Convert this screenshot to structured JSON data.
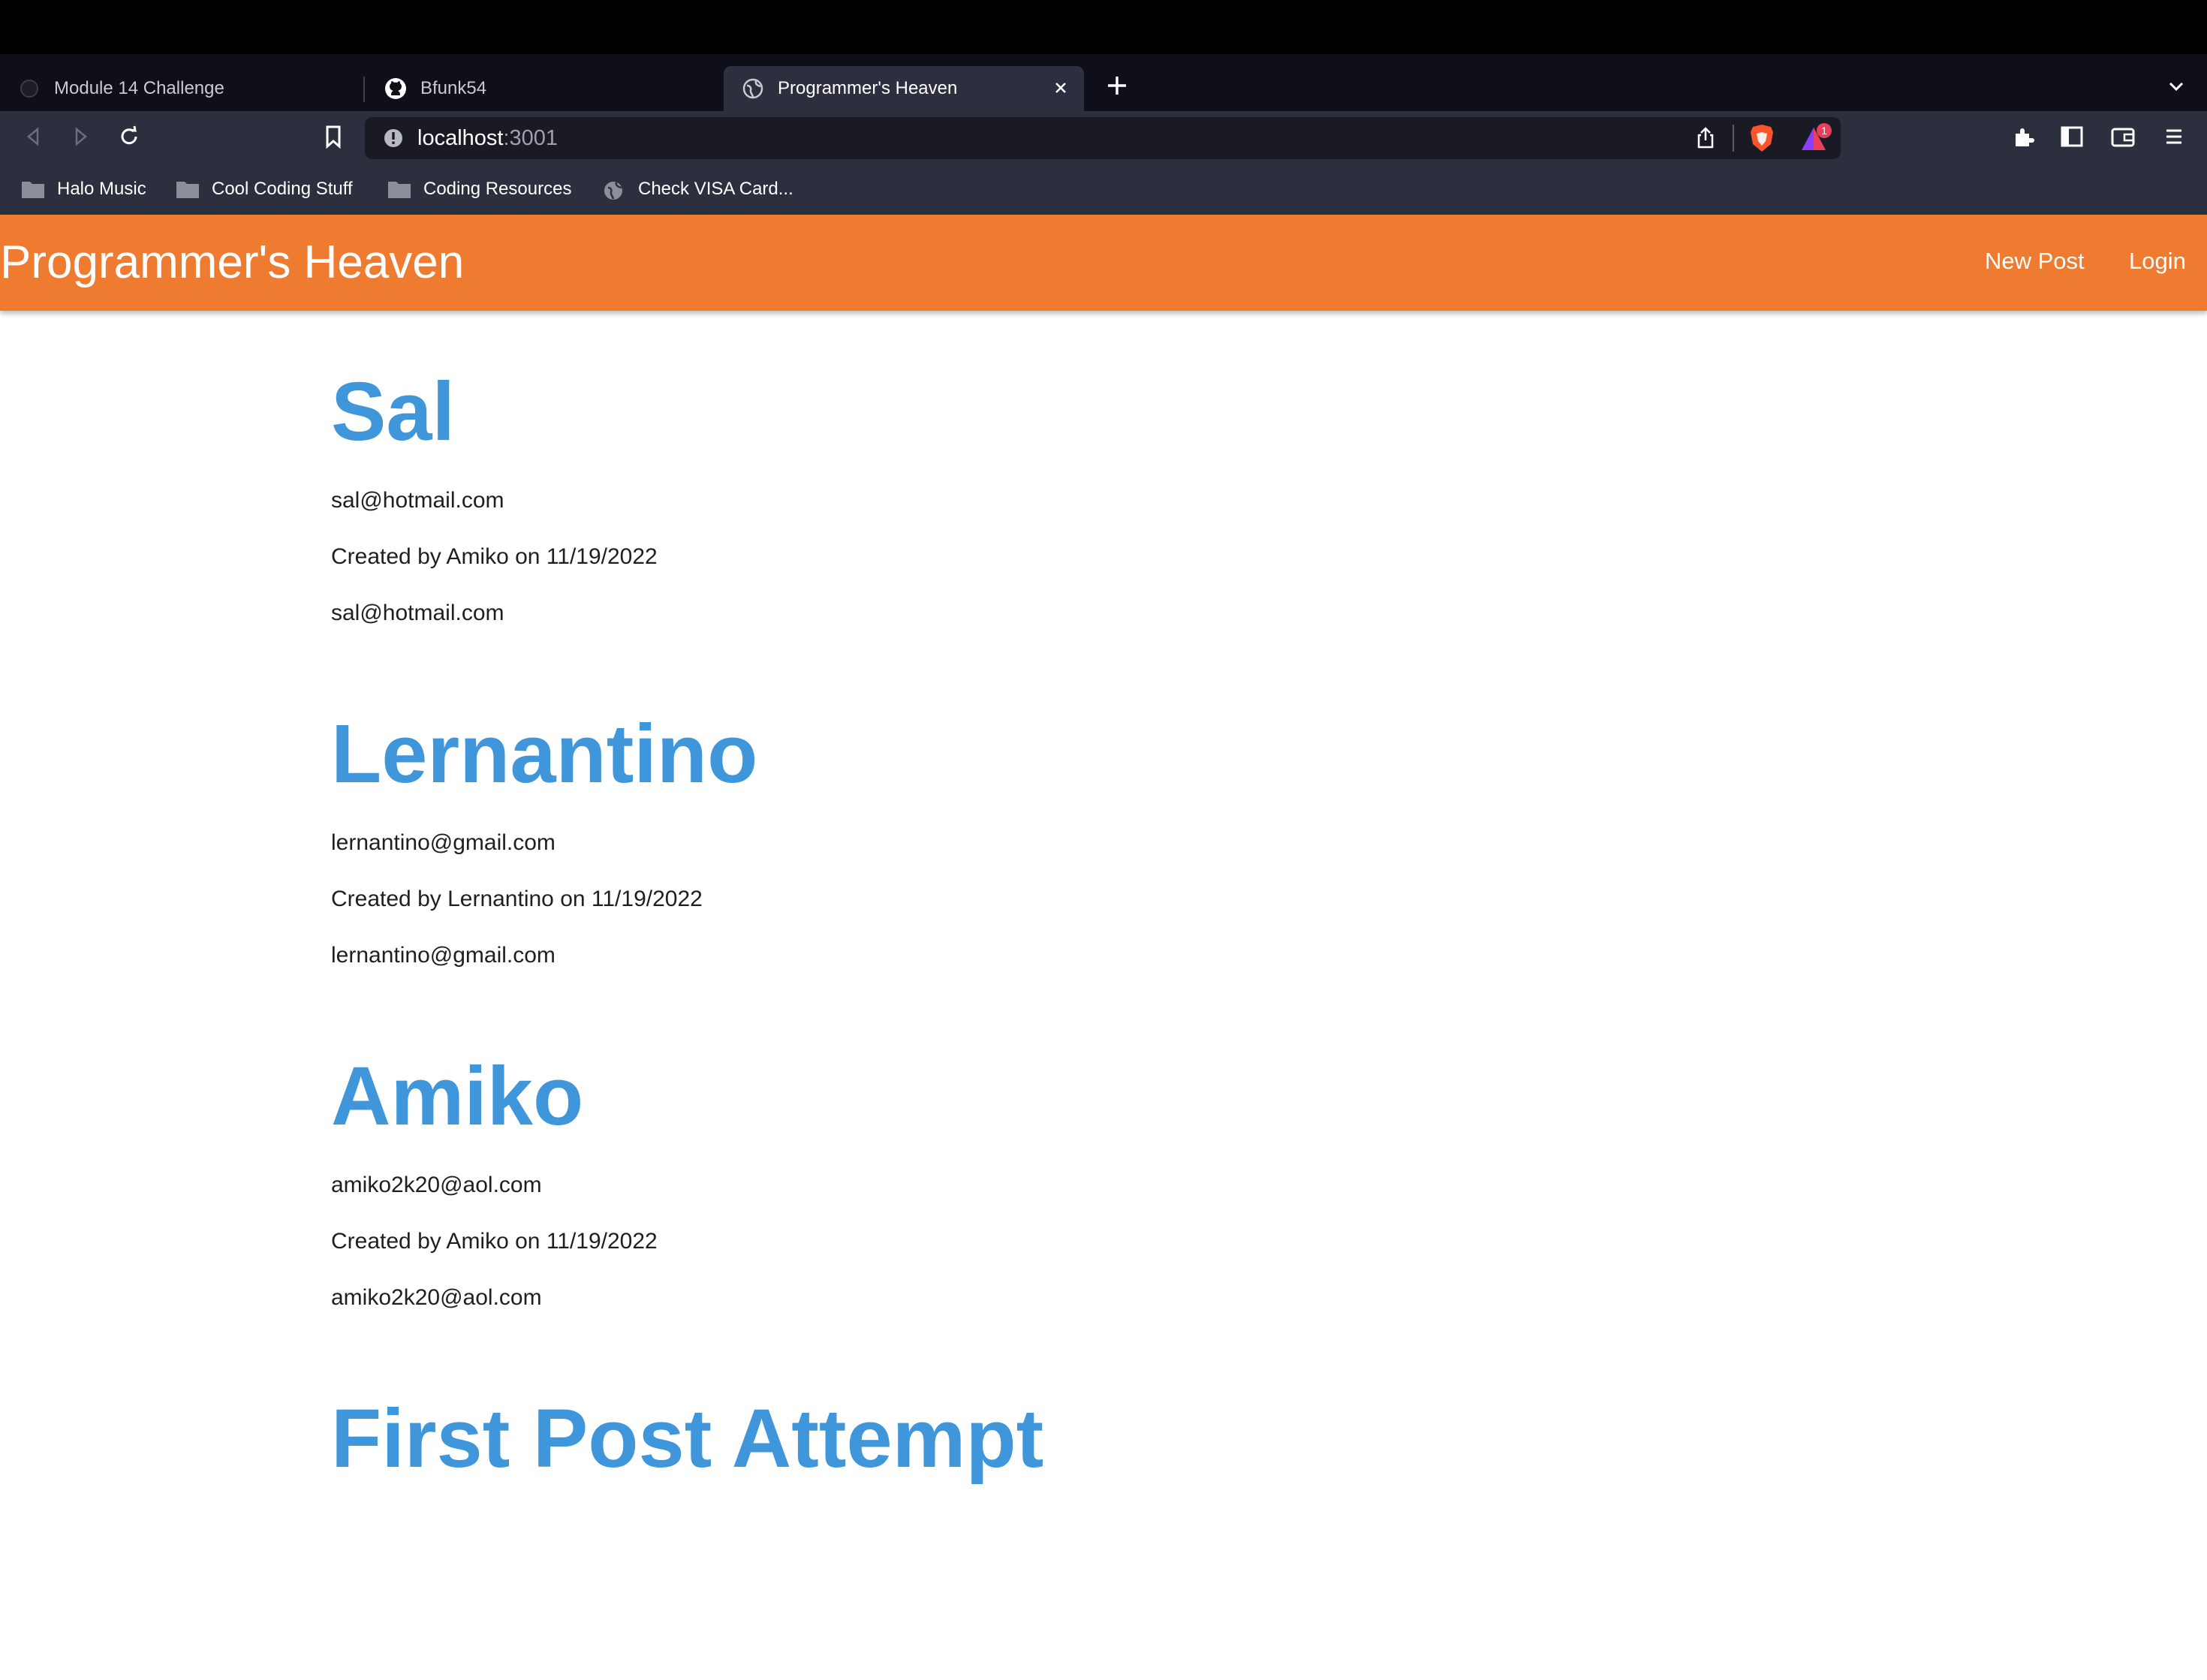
{
  "browser": {
    "tabs": [
      {
        "title": "Module 14 Challenge",
        "active": false,
        "icon": "globe-icon"
      },
      {
        "title": "Bfunk54",
        "active": false,
        "icon": "github-icon"
      },
      {
        "title": "Programmer's Heaven",
        "active": true,
        "icon": "globe-icon"
      }
    ],
    "url_host": "localhost",
    "url_port": ":3001",
    "shields_badge": "1",
    "bookmarks": [
      {
        "label": "Halo Music",
        "icon": "folder-icon"
      },
      {
        "label": "Cool Coding Stuff",
        "icon": "folder-icon"
      },
      {
        "label": "Coding Resources",
        "icon": "folder-icon"
      },
      {
        "label": "Check VISA Card...",
        "icon": "globe-icon"
      }
    ]
  },
  "app": {
    "brand": "Programmer's Heaven",
    "nav": {
      "new_post": "New Post",
      "login": "Login"
    },
    "accent_color": "#ef7b31",
    "title_color": "#3f96db"
  },
  "posts": [
    {
      "title": "Sal",
      "line1": "sal@hotmail.com",
      "meta": "Created by Amiko on 11/19/2022",
      "line3": "sal@hotmail.com"
    },
    {
      "title": "Lernantino",
      "line1": "lernantino@gmail.com",
      "meta": "Created by Lernantino on 11/19/2022",
      "line3": "lernantino@gmail.com"
    },
    {
      "title": "Amiko",
      "line1": "amiko2k20@aol.com",
      "meta": "Created by Amiko on 11/19/2022",
      "line3": "amiko2k20@aol.com"
    },
    {
      "title": "First Post Attempt"
    }
  ]
}
